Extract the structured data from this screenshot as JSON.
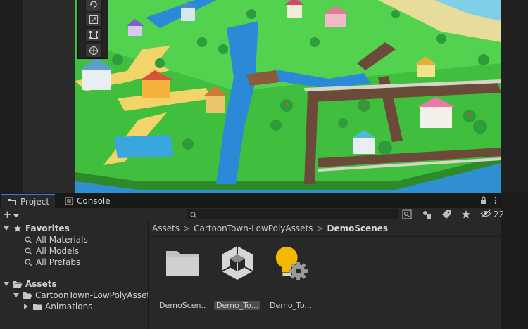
{
  "scene": {
    "tools": [
      "rotate-tool",
      "scale-tool",
      "rect-tool",
      "transform-tool"
    ]
  },
  "tabs": [
    {
      "label": "Project",
      "icon": "folder-icon",
      "active": true
    },
    {
      "label": "Console",
      "icon": "console-icon",
      "active": false
    }
  ],
  "toolbar": {
    "add_label": "+",
    "search_placeholder": "",
    "hidden_count": "22"
  },
  "favorites": {
    "label": "Favorites",
    "items": [
      "All Materials",
      "All Models",
      "All Prefabs"
    ]
  },
  "assets_tree": {
    "label": "Assets",
    "children": [
      {
        "label": "CartoonTown-LowPolyAssets"
      },
      {
        "label": "Animations"
      }
    ]
  },
  "breadcrumb": {
    "items": [
      "Assets",
      "CartoonTown-LowPolyAssets"
    ],
    "current": "DemoScenes",
    "separator": ">"
  },
  "assets": [
    {
      "label": "DemoScen...",
      "icon": "folder-icon",
      "selected": false
    },
    {
      "label": "Demo_To...",
      "icon": "unity-scene-icon",
      "selected": true
    },
    {
      "label": "Demo_To...",
      "icon": "lighting-settings-icon",
      "selected": false
    }
  ],
  "colors": {
    "accent": "#3a7bd5",
    "panel_bg": "#282828",
    "water": "#2f8fd0",
    "grass": "#4cd04a"
  }
}
